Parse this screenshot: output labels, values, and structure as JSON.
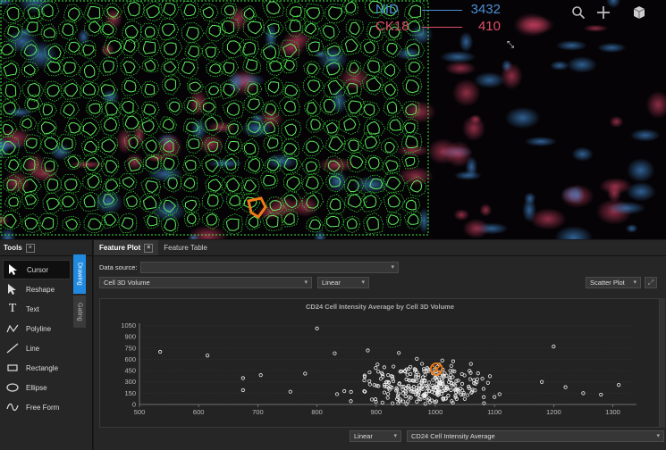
{
  "viewer": {
    "channels": [
      {
        "name": "NID",
        "value": "3432",
        "color": "#4c8fd6"
      },
      {
        "name": "CK18",
        "value": "410",
        "color": "#e0506a"
      }
    ],
    "icons": [
      "search-icon",
      "plus-icon",
      "cube-icon"
    ]
  },
  "tools": {
    "title": "Tools",
    "items": [
      {
        "label": "Cursor",
        "icon": "cursor-arrow-icon"
      },
      {
        "label": "Reshape",
        "icon": "reshape-arrow-icon"
      },
      {
        "label": "Text",
        "icon": "text-icon"
      },
      {
        "label": "Polyline",
        "icon": "polyline-icon"
      },
      {
        "label": "Line",
        "icon": "line-icon"
      },
      {
        "label": "Rectangle",
        "icon": "rectangle-icon"
      },
      {
        "label": "Ellipse",
        "icon": "ellipse-icon"
      },
      {
        "label": "Free Form",
        "icon": "freeform-icon"
      }
    ],
    "side_tabs": [
      "Drawing",
      "Gating"
    ]
  },
  "feature_panel": {
    "tabs": [
      "Feature Plot",
      "Feature Table"
    ],
    "data_source_label": "Data source:",
    "data_source_value": "",
    "x_feature": "Cell 3D Volume",
    "x_scale": "Linear",
    "plot_type": "Scatter Plot",
    "y_scale": "Linear",
    "y_feature": "CD24 Cell Intensity Average"
  },
  "chart_data": {
    "type": "scatter",
    "title": "CD24 Cell Intensity Average by Cell 3D Volume",
    "xlabel": "",
    "ylabel": "",
    "xlim": [
      500,
      1340
    ],
    "ylim": [
      0,
      1080
    ],
    "xticks": [
      500,
      600,
      700,
      800,
      900,
      1000,
      1100,
      1200,
      1300
    ],
    "yticks": [
      0,
      150,
      300,
      450,
      600,
      750,
      900,
      1050
    ],
    "selected_point": {
      "x": 1002,
      "y": 470
    }
  }
}
